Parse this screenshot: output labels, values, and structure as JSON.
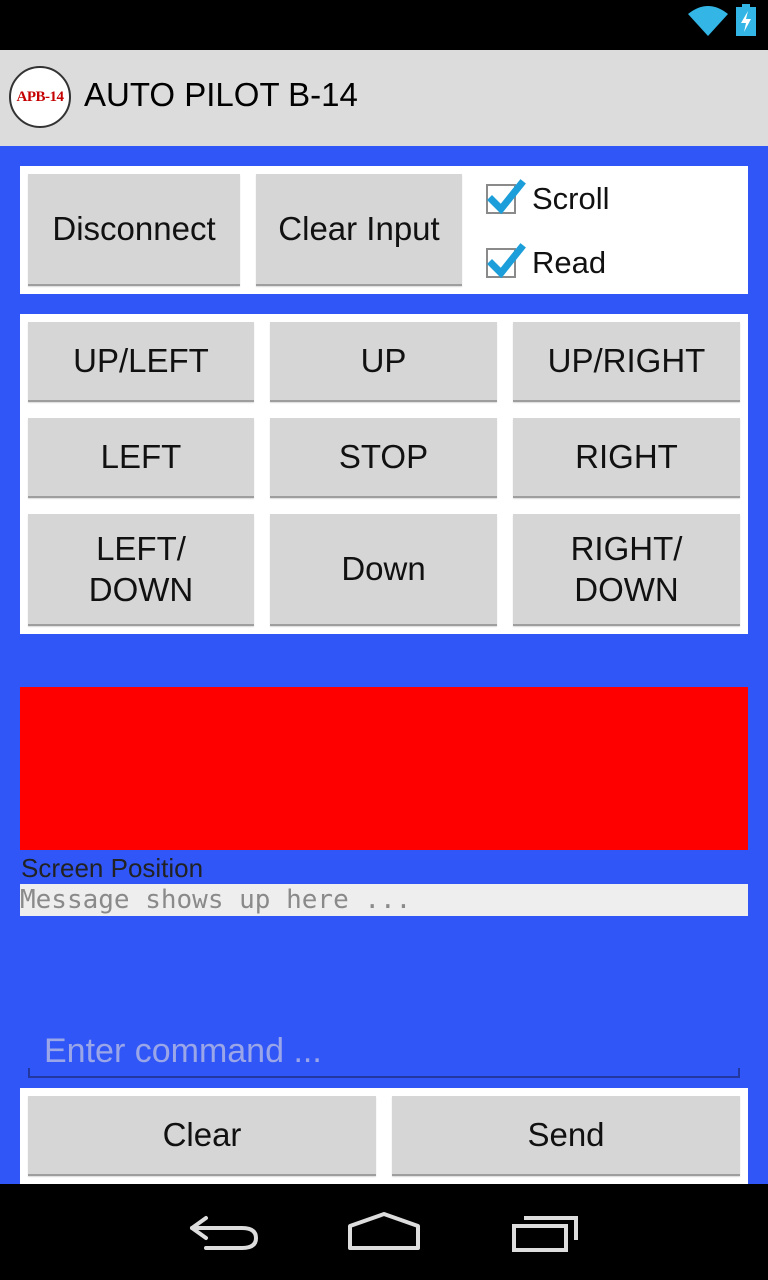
{
  "app": {
    "title": "AUTO PILOT B-14",
    "logo_text": "APB-14"
  },
  "colors": {
    "background": "#3056f7",
    "action_bar": "#dcdcdc",
    "status_display": "#ff0000",
    "button": "#d6d6d6",
    "checkbox_accent": "#1b9ed9"
  },
  "status_bar": {
    "icons": [
      "wifi-icon",
      "battery-charging-icon"
    ]
  },
  "top_controls": {
    "disconnect_label": "Disconnect",
    "clear_input_label": "Clear Input",
    "scroll": {
      "label": "Scroll",
      "checked": true
    },
    "read": {
      "label": "Read",
      "checked": true
    }
  },
  "direction_pad": {
    "up_left": "UP/LEFT",
    "up": "UP",
    "up_right": "UP/RIGHT",
    "left": "LEFT",
    "stop": "STOP",
    "right": "RIGHT",
    "left_down": "LEFT/\nDOWN",
    "down": "Down",
    "right_down": "RIGHT/\nDOWN"
  },
  "display": {
    "screen_position_label": "Screen Position",
    "message_placeholder": "Message shows up here ..."
  },
  "command": {
    "placeholder": "Enter command ...",
    "value": ""
  },
  "bottom_controls": {
    "clear_label": "Clear",
    "send_label": "Send"
  },
  "navigation": {
    "icons": [
      "back-icon",
      "home-icon",
      "recent-apps-icon"
    ]
  }
}
